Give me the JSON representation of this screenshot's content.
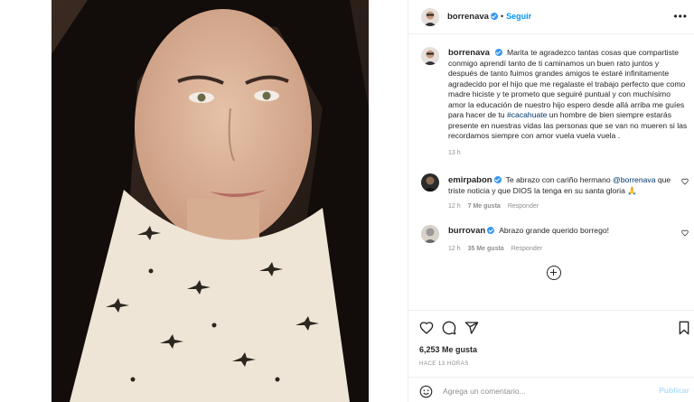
{
  "post": {
    "author": "borrenava",
    "follow_label": "Seguir",
    "more_label": "•••",
    "caption_text": "Marita te agradezco tantas cosas que compartiste conmigo aprendí tanto de ti caminamos un buen rato juntos y después de tanto fuimos grandes amigos te estaré infinitamente agradecido por el hijo que me regalaste el trabajo perfecto que como madre hiciste y te prometo que seguiré puntual y con muchísimo amor la educación de nuestro hijo espero desde allá arriba me guíes para hacer de tu ",
    "caption_hashtag": "#cacahuate",
    "caption_tail": " un hombre de bien siempre estarás presente en nuestras vidas las personas que se van no mueren si las recordamos siempre con amor vuela vuela vuela .",
    "caption_time": "13 h"
  },
  "comments": [
    {
      "user": "emirpabon",
      "text_before": "Te abrazo con cariño hermano ",
      "mention": "@borrenava",
      "text_after": " que triste noticia y que DIOS la tenga en su santa gloria 🙏",
      "time": "12 h",
      "likes": "7 Me gusta",
      "reply": "Responder"
    },
    {
      "user": "burrovan",
      "text_before": "Abrazo grande querido borrego!",
      "time": "12 h",
      "likes": "35 Me gusta",
      "reply": "Responder"
    }
  ],
  "stats": {
    "likes": "6,253 Me gusta",
    "date": "HACE 13 HORAS"
  },
  "composer": {
    "placeholder": "Agrega un comentario...",
    "publish_label": "Publicar"
  },
  "colors": {
    "accent": "#0095f6",
    "verified": "#3897f0",
    "publish_disabled": "#b2dffc"
  }
}
